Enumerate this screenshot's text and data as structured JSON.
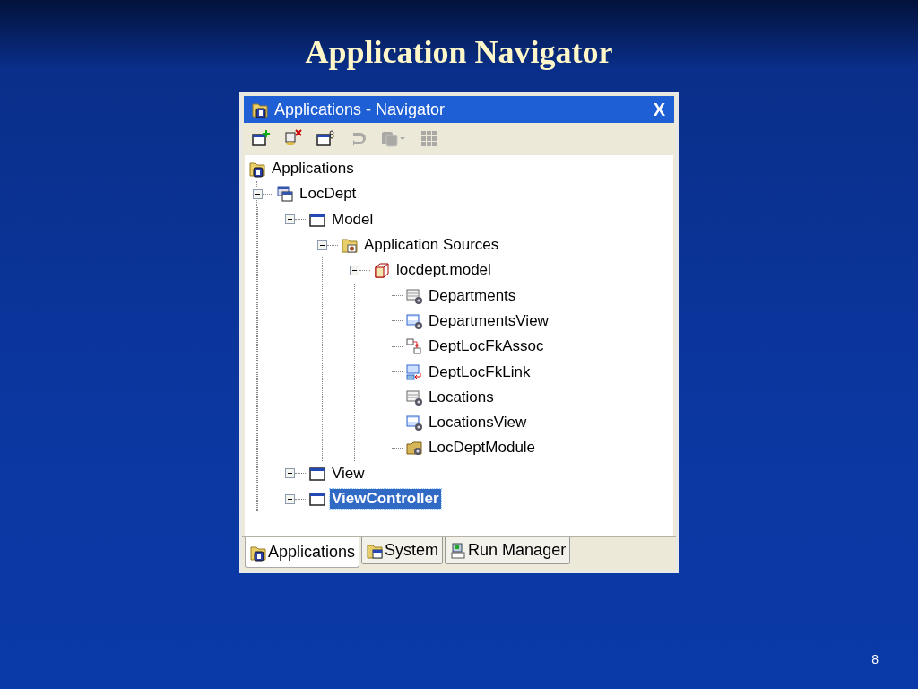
{
  "slide": {
    "title": "Application Navigator",
    "page_number": "8"
  },
  "window": {
    "title": "Applications - Navigator",
    "close": "X"
  },
  "toolbar": [
    {
      "kind": "new-app",
      "disabled": false
    },
    {
      "kind": "remove",
      "disabled": false
    },
    {
      "kind": "new-project",
      "disabled": false
    },
    {
      "kind": "undo",
      "disabled": true
    },
    {
      "kind": "copy-menu",
      "disabled": true
    },
    {
      "kind": "grid",
      "disabled": true
    }
  ],
  "tree": {
    "label": "Applications",
    "kind": "app-root",
    "selected": false,
    "children": [
      {
        "label": "LocDept",
        "kind": "workspace",
        "selected": false,
        "expanded": true,
        "children": [
          {
            "label": "Model",
            "kind": "project",
            "selected": false,
            "expanded": true,
            "children": [
              {
                "label": "Application Sources",
                "kind": "sources",
                "selected": false,
                "expanded": true,
                "children": [
                  {
                    "label": "locdept.model",
                    "kind": "package",
                    "selected": false,
                    "expanded": true,
                    "children": [
                      {
                        "label": "Departments",
                        "kind": "entity",
                        "selected": false
                      },
                      {
                        "label": "DepartmentsView",
                        "kind": "view-object",
                        "selected": false
                      },
                      {
                        "label": "DeptLocFkAssoc",
                        "kind": "association",
                        "selected": false
                      },
                      {
                        "label": "DeptLocFkLink",
                        "kind": "view-link",
                        "selected": false
                      },
                      {
                        "label": "Locations",
                        "kind": "entity",
                        "selected": false
                      },
                      {
                        "label": "LocationsView",
                        "kind": "view-object",
                        "selected": false
                      },
                      {
                        "label": "LocDeptModule",
                        "kind": "module",
                        "selected": false
                      }
                    ]
                  }
                ]
              }
            ]
          },
          {
            "label": "View",
            "kind": "project",
            "selected": false,
            "expanded": false
          },
          {
            "label": "ViewController",
            "kind": "project",
            "selected": true,
            "expanded": false
          }
        ]
      }
    ]
  },
  "tabs": [
    {
      "label": "Applications",
      "kind": "app-root",
      "selected": true
    },
    {
      "label": "System",
      "kind": "system",
      "selected": false
    },
    {
      "label": "Run Manager",
      "kind": "run",
      "selected": false
    }
  ]
}
